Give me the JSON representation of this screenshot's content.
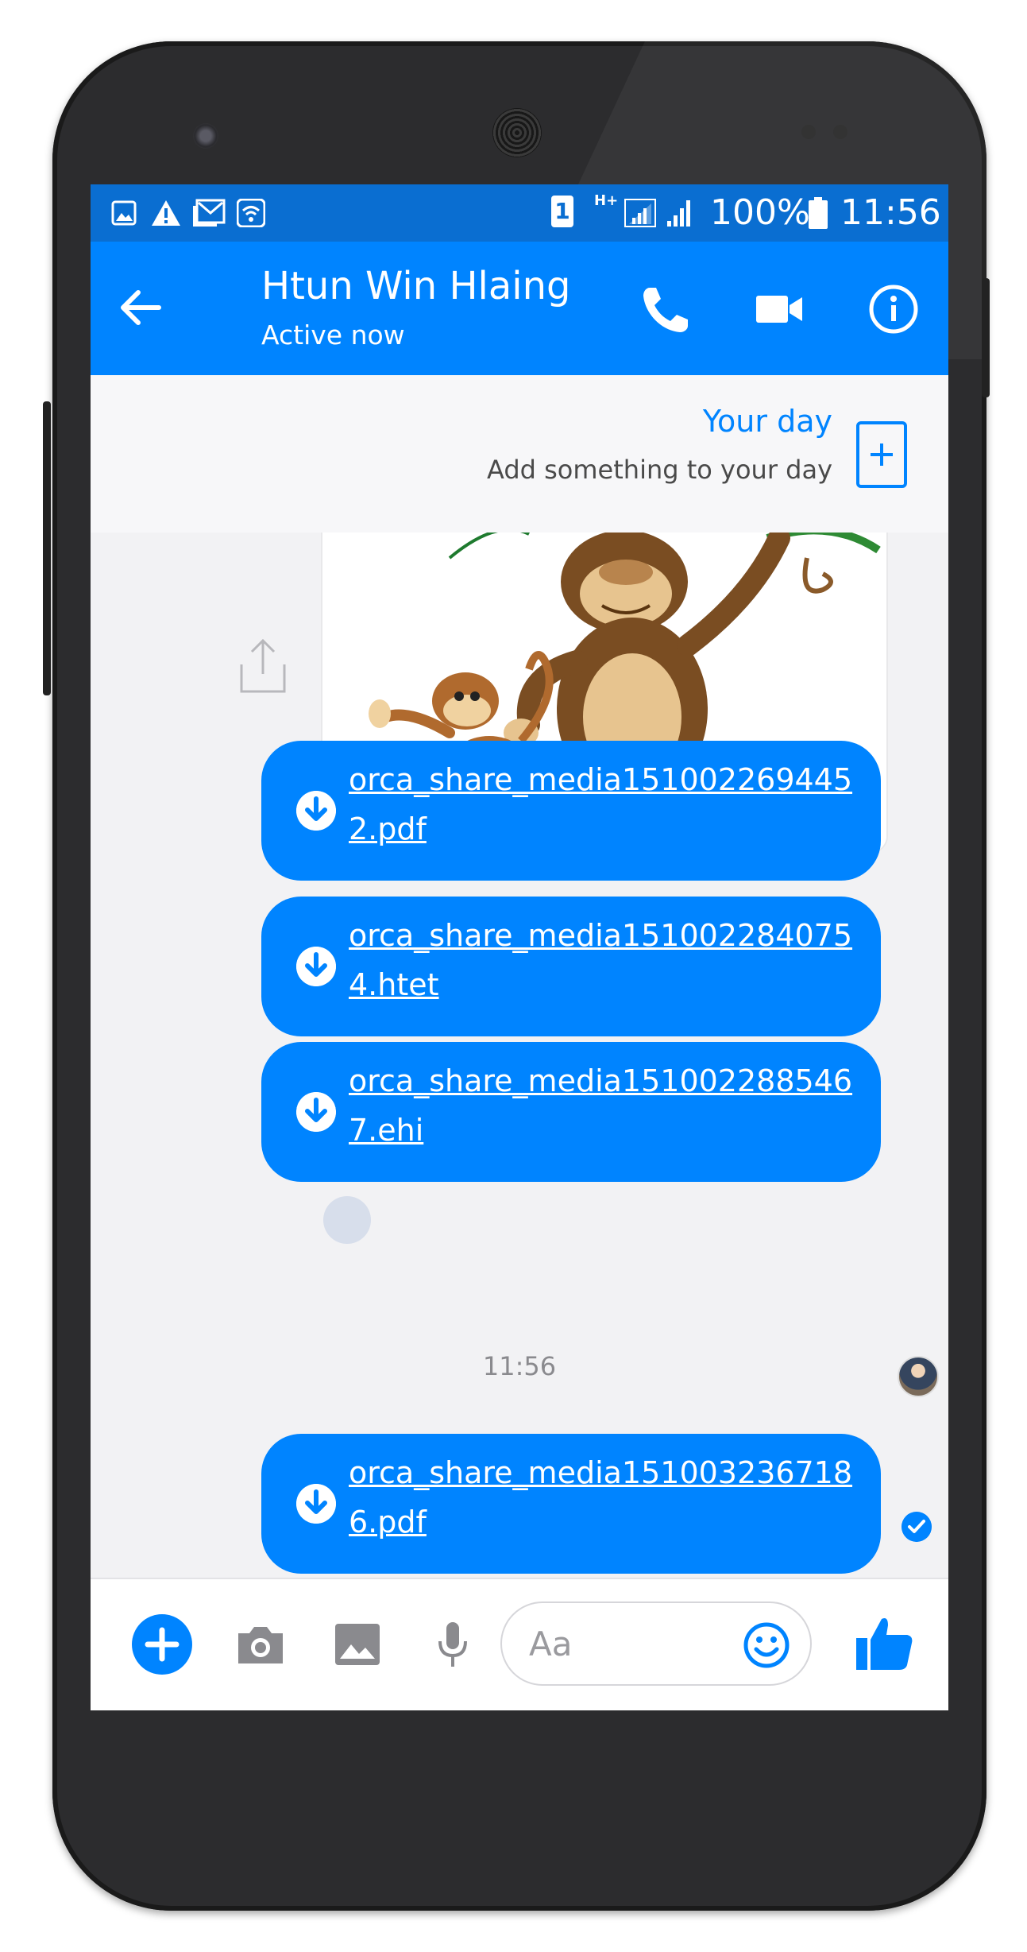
{
  "status_bar": {
    "sim": "1",
    "network": "H+",
    "battery": "100%",
    "time": "11:56",
    "left_icons": [
      "gallery-icon",
      "warning-icon",
      "gmail-icon",
      "wifi-icon"
    ]
  },
  "header": {
    "contact_name": "Htun Win Hlaing",
    "status": "Active now",
    "icons": [
      "back-arrow-icon",
      "phone-icon",
      "video-camera-icon",
      "info-icon"
    ]
  },
  "your_day": {
    "title": "Your day",
    "subtitle": "Add something to your day"
  },
  "messages": [
    {
      "type": "image",
      "description_icon": "monkeys-image"
    },
    {
      "type": "file",
      "filename": "orca_share_media1510022694452.pdf"
    },
    {
      "type": "file",
      "filename": "orca_share_media1510022840754.htet"
    },
    {
      "type": "file",
      "filename": "orca_share_media1510022885467.ehi"
    },
    {
      "type": "timestamp",
      "text": "11:56"
    },
    {
      "type": "file",
      "filename": "orca_share_media1510032367186.pdf"
    }
  ],
  "composer": {
    "placeholder": "Aa",
    "icons": [
      "plus-icon",
      "camera-icon",
      "image-icon",
      "microphone-icon",
      "emoji-icon",
      "thumbs-up-icon"
    ]
  },
  "colors": {
    "accent": "#0084ff",
    "status_bar": "#0a6ed1",
    "thread_bg": "#f2f2f4"
  }
}
